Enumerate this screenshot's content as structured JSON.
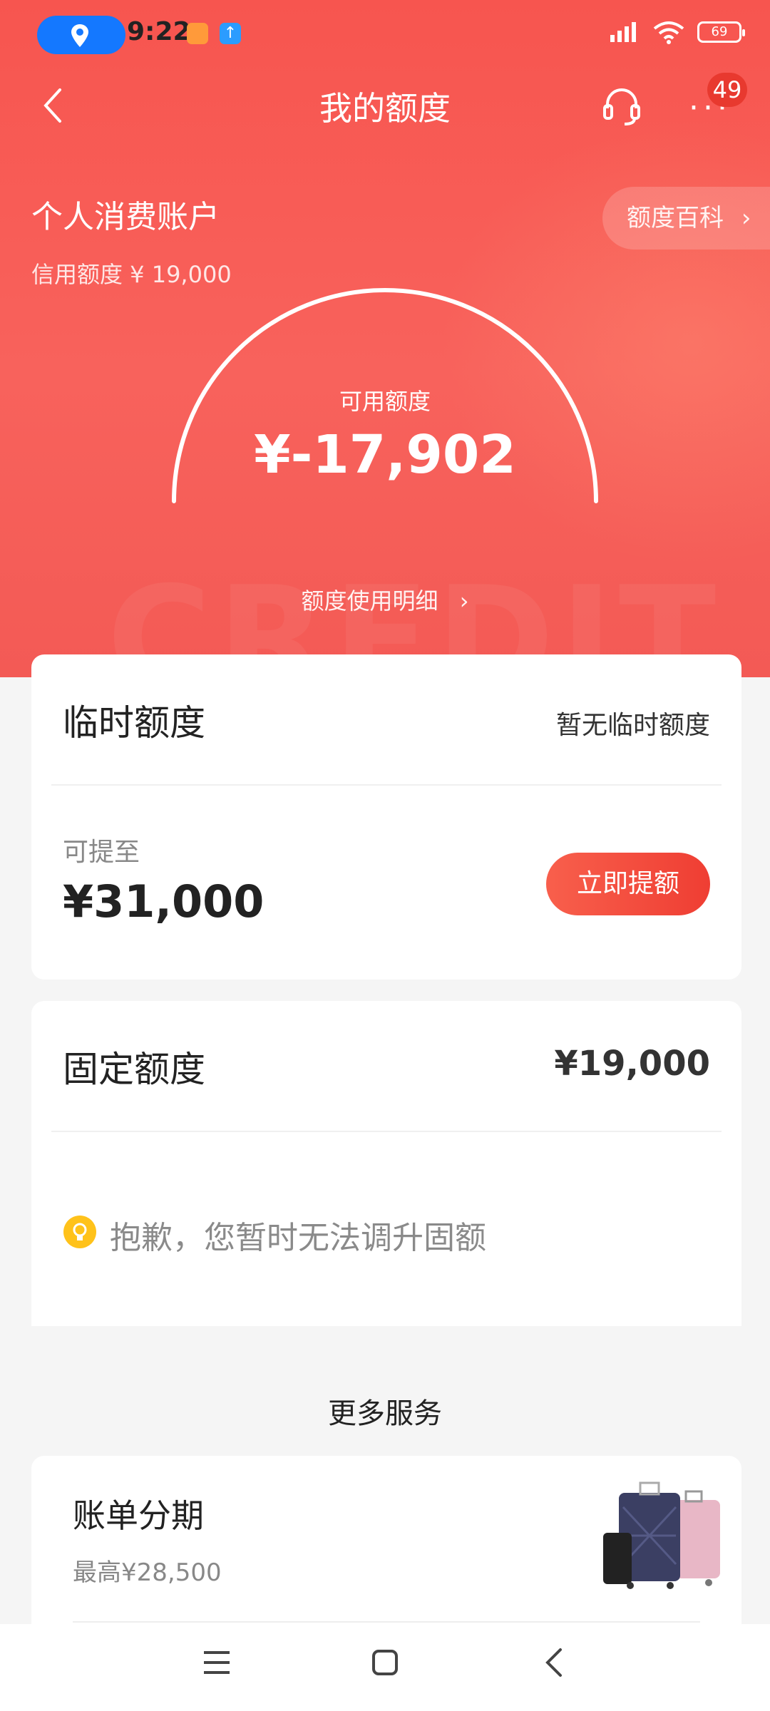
{
  "status_bar": {
    "time": "9:22",
    "battery": "69"
  },
  "nav": {
    "title": "我的额度",
    "badge": "49"
  },
  "account": {
    "title": "个人消费账户",
    "credit_limit": "信用额度 ¥ 19,000",
    "wiki_link": "额度百科"
  },
  "available": {
    "label": "可用额度",
    "value": "¥-17,902"
  },
  "usage_link": "额度使用明细",
  "temp_limit": {
    "title": "临时额度",
    "status": "暂无临时额度",
    "raise_label": "可提至",
    "raise_amount": "¥31,000",
    "button": "立即提额"
  },
  "fixed_limit": {
    "title": "固定额度",
    "amount": "¥19,000",
    "notice": "抱歉，您暂时无法调升固额"
  },
  "more_services": {
    "heading": "更多服务",
    "items": [
      {
        "title": "账单分期",
        "subtitle": "最高¥28,500"
      }
    ]
  },
  "colors": {
    "accent": "#f7554f",
    "button": "#ef3e33"
  }
}
